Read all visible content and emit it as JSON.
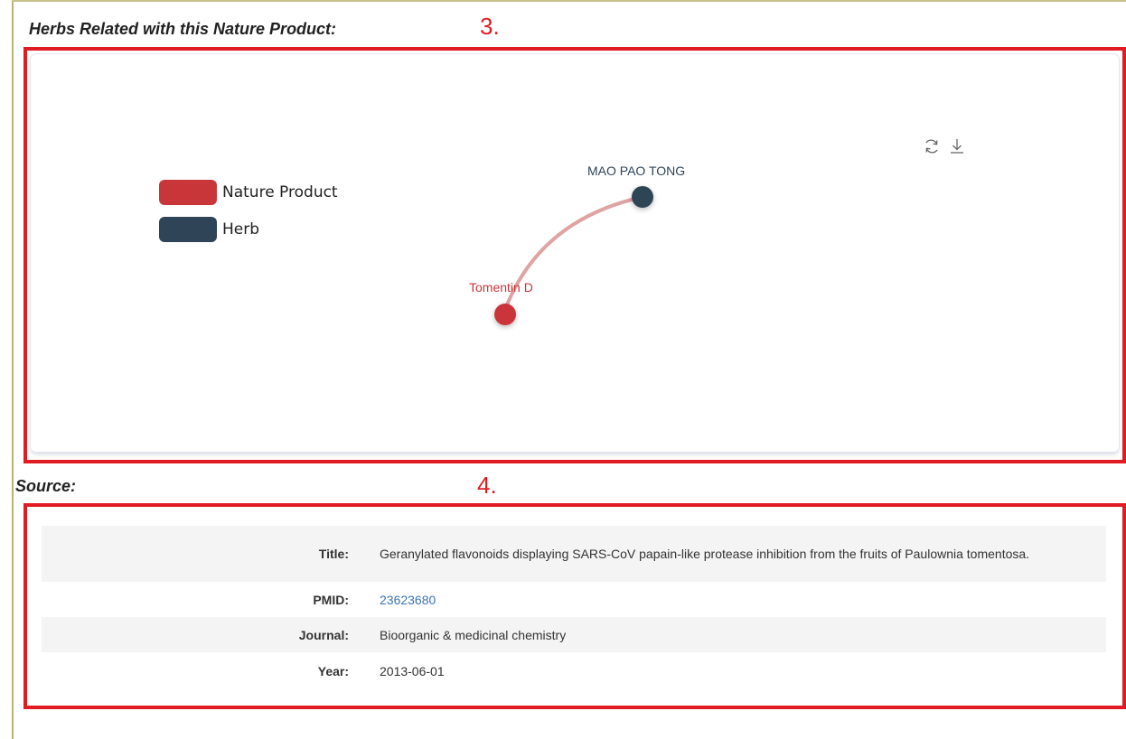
{
  "section3": {
    "heading": "Herbs Related with this Nature Product:",
    "marker": "3."
  },
  "legend": [
    {
      "label": "Nature Product",
      "color": "#c9363a"
    },
    {
      "label": "Herb",
      "color": "#2f4456"
    }
  ],
  "toolbox": {
    "restore_icon": "refresh-icon",
    "save_icon": "download-icon"
  },
  "graph": {
    "nodes": [
      {
        "name": "MAO PAO TONG",
        "type": "Herb",
        "color": "#2f4456"
      },
      {
        "name": "Tomentin D",
        "type": "Nature Product",
        "color": "#c9363a"
      }
    ],
    "edge_color": "#e0a3a3"
  },
  "section4": {
    "heading": "Source:",
    "marker": "4."
  },
  "source": {
    "title_key": "Title:",
    "title_value": "Geranylated flavonoids displaying SARS-CoV papain-like protease inhibition from the fruits of Paulownia tomentosa.",
    "pmid_key": "PMID:",
    "pmid_value": "23623680",
    "journal_key": "Journal:",
    "journal_value": "Bioorganic & medicinal chemistry",
    "year_key": "Year:",
    "year_value": "2013-06-01",
    "link_color": "#3a75b0"
  },
  "annotation_color": "#e11b22"
}
